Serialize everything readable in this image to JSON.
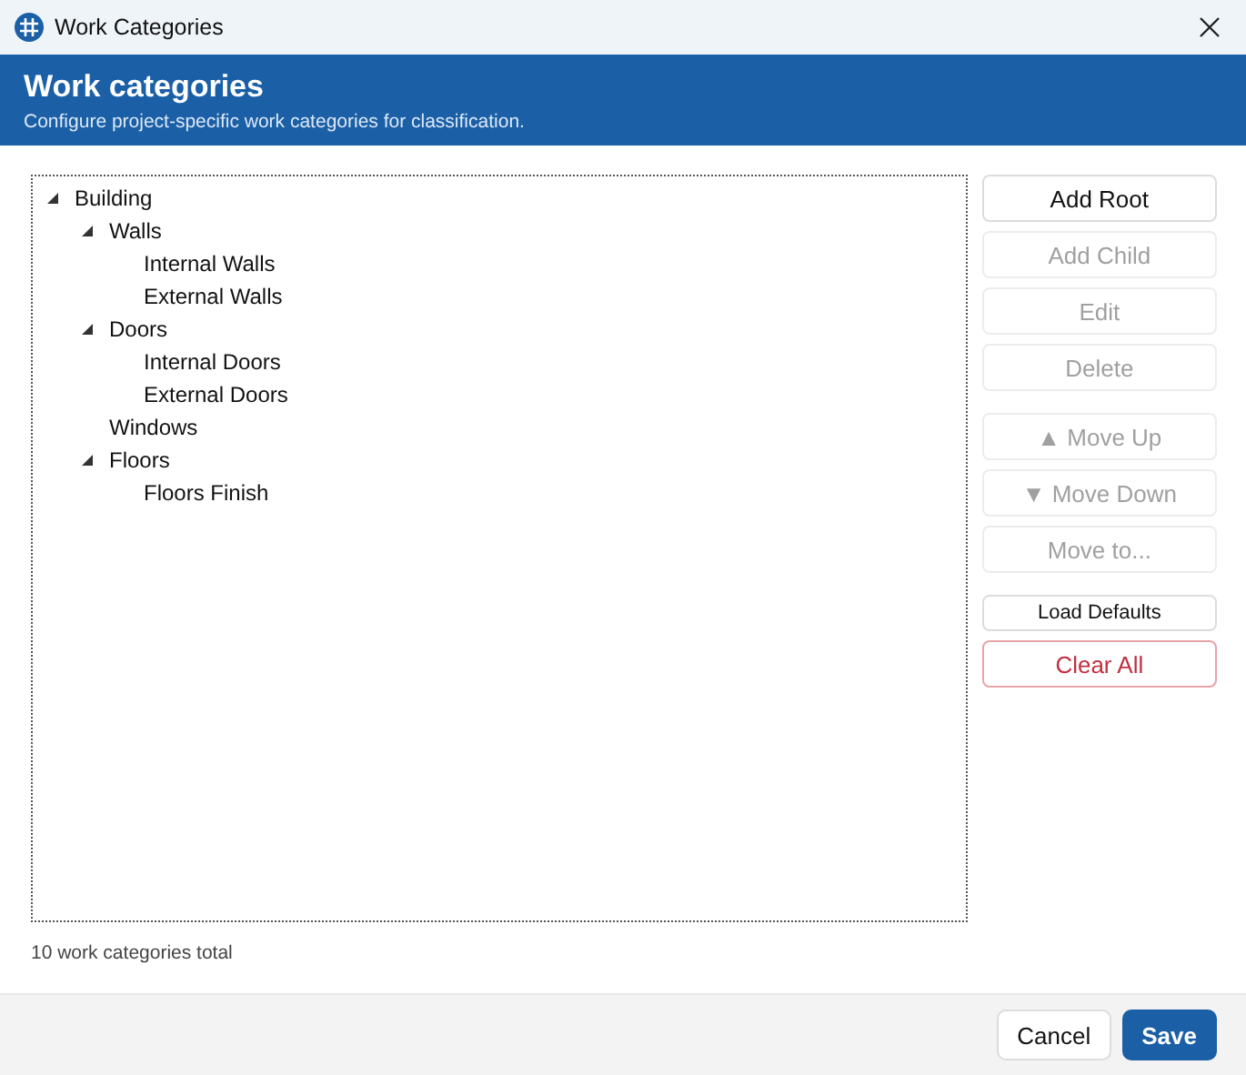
{
  "window": {
    "title": "Work Categories"
  },
  "header": {
    "title": "Work categories",
    "subtitle": "Configure project-specific work categories for classification."
  },
  "tree": [
    {
      "label": "Building",
      "expanded": true,
      "children": [
        {
          "label": "Walls",
          "expanded": true,
          "children": [
            {
              "label": "Internal Walls"
            },
            {
              "label": "External Walls"
            }
          ]
        },
        {
          "label": "Doors",
          "expanded": true,
          "children": [
            {
              "label": "Internal Doors"
            },
            {
              "label": "External Doors"
            }
          ]
        },
        {
          "label": "Windows"
        },
        {
          "label": "Floors",
          "expanded": true,
          "children": [
            {
              "label": "Floors Finish"
            }
          ]
        }
      ]
    }
  ],
  "button_groups": [
    [
      {
        "label": "Add Root",
        "kind": "normal",
        "disabled": false
      },
      {
        "label": "Add Child",
        "kind": "normal",
        "disabled": true
      },
      {
        "label": "Edit",
        "kind": "normal",
        "disabled": true
      },
      {
        "label": "Delete",
        "kind": "normal",
        "disabled": true
      }
    ],
    [
      {
        "label": "▲ Move Up",
        "kind": "normal",
        "disabled": true
      },
      {
        "label": "▼ Move Down",
        "kind": "normal",
        "disabled": true
      },
      {
        "label": "Move to...",
        "kind": "normal",
        "disabled": true
      }
    ],
    [
      {
        "label": "Load Defaults",
        "kind": "small",
        "disabled": false
      },
      {
        "label": "Clear All",
        "kind": "danger",
        "disabled": false
      }
    ]
  ],
  "status": "10 work categories total",
  "footer_buttons": [
    {
      "label": "Cancel",
      "kind": "secondary"
    },
    {
      "label": "Save",
      "kind": "primary"
    }
  ]
}
